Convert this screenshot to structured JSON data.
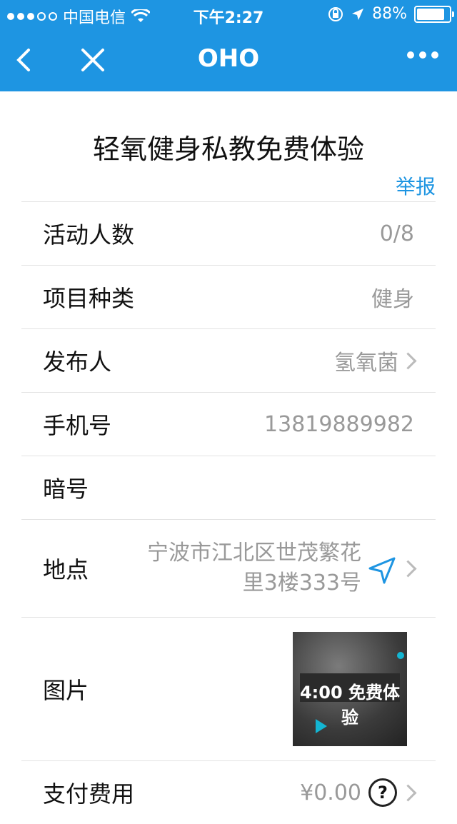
{
  "status_bar": {
    "carrier": "中国电信",
    "time": "下午2:27",
    "battery": "88%",
    "signal_dots": 3
  },
  "nav": {
    "title": "OHO",
    "icons": [
      "back-arrow-icon",
      "close-icon",
      "more-icon"
    ]
  },
  "page": {
    "title": "轻氧健身私教免费体验",
    "report_label": "举报"
  },
  "rows": [
    {
      "label": "活动人数",
      "value": "0/8"
    },
    {
      "label": "项目种类",
      "value": "健身"
    },
    {
      "label": "发布人",
      "value": "氢氧菌"
    },
    {
      "label": "手机号",
      "value": "13819889982"
    },
    {
      "label": "暗号",
      "value": ""
    },
    {
      "label": "地点",
      "value_line1": "宁波市江北区世茂繁花",
      "value_line2": "里3楼333号"
    },
    {
      "label": "图片",
      "image_text": "4:00 免费体验"
    },
    {
      "label": "支付费用",
      "value": "¥0.00"
    }
  ],
  "colors": {
    "accent": "#1e95e2",
    "label_text": "#111111",
    "value_text": "#999999"
  }
}
